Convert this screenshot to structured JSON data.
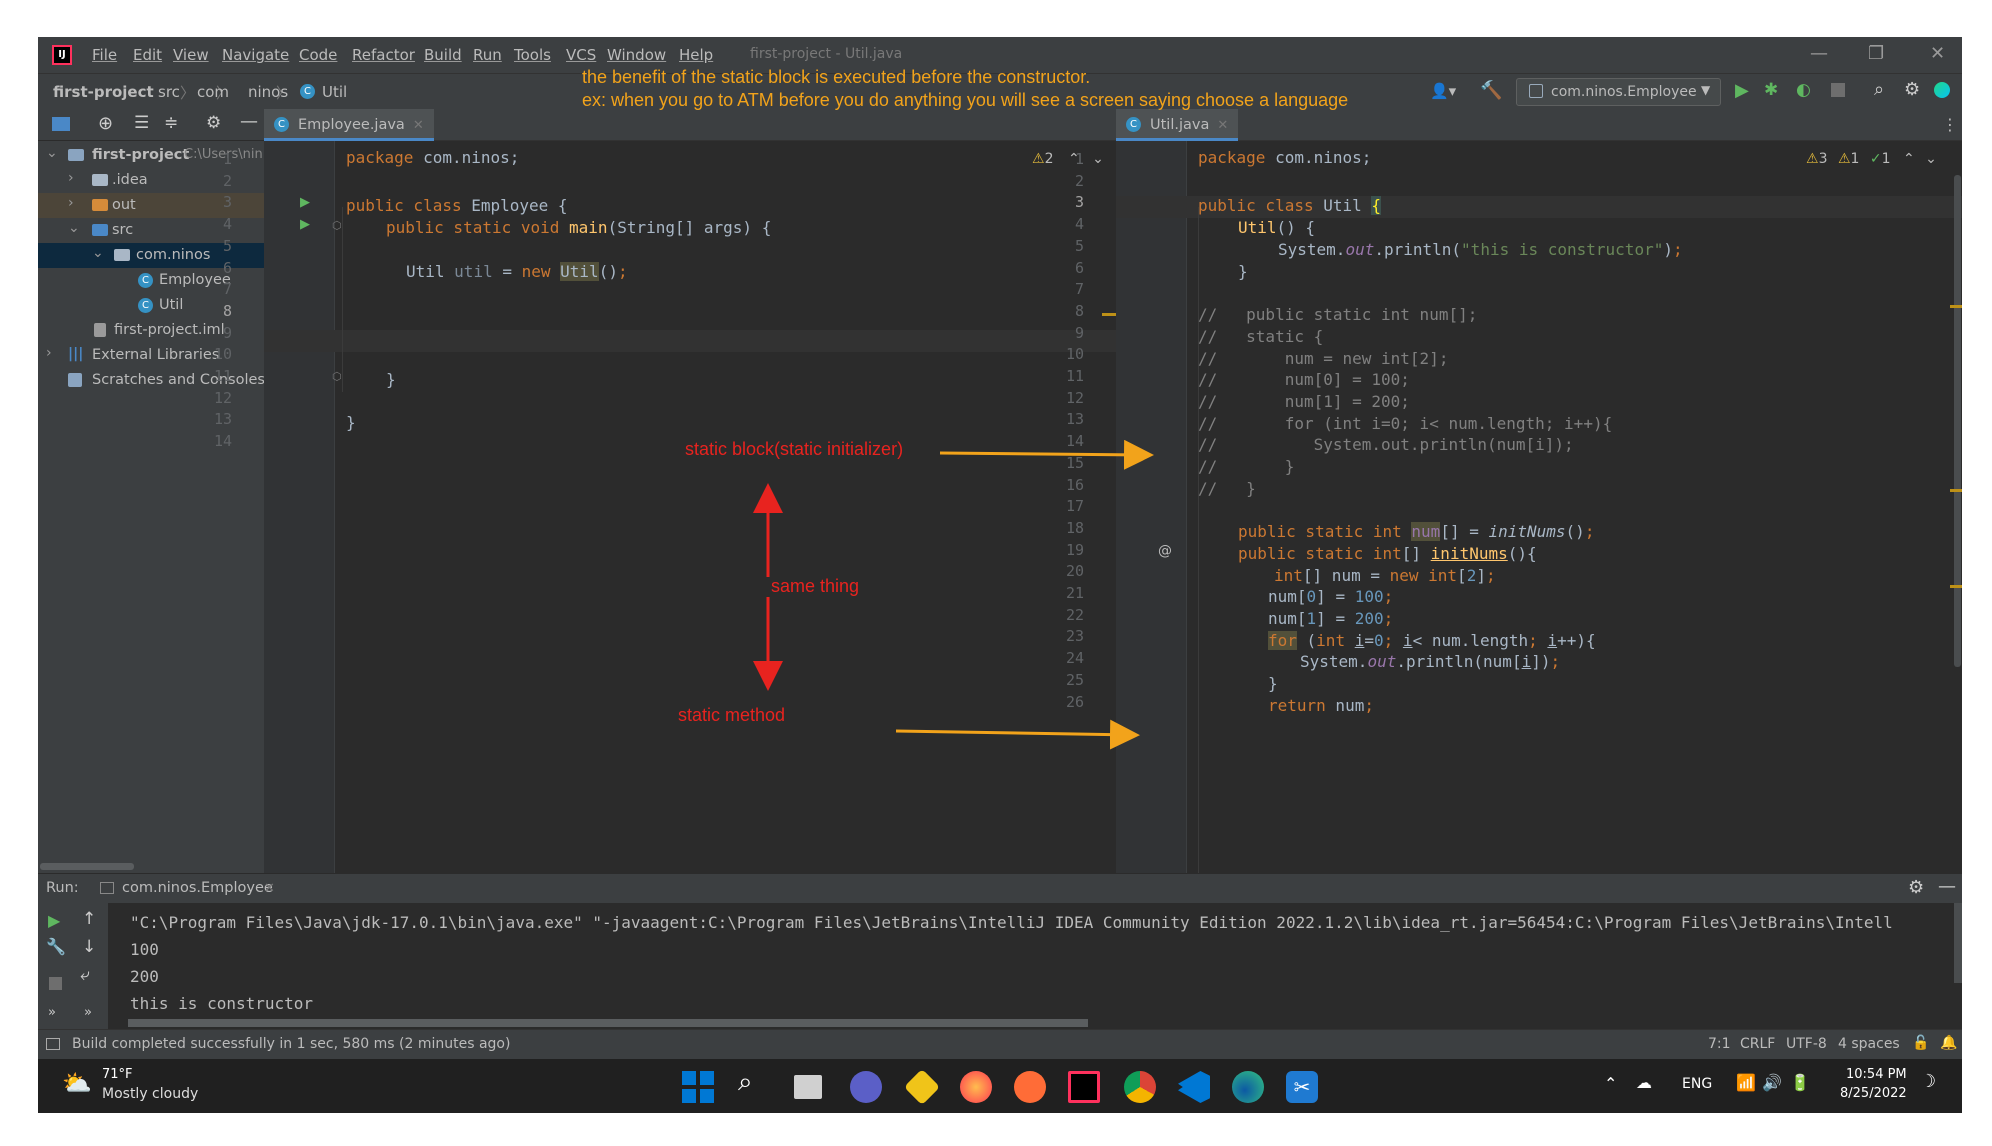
{
  "menu": {
    "items": [
      "File",
      "Edit",
      "View",
      "Navigate",
      "Code",
      "Refactor",
      "Build",
      "Run",
      "Tools",
      "VCS",
      "Window",
      "Help"
    ],
    "window_title": "first-project - Util.java"
  },
  "breadcrumb": {
    "project": "first-project",
    "src": "src",
    "com": "com",
    "ninos": "ninos",
    "cls": "Util"
  },
  "run_config": "com.ninos.Employee",
  "project_tree": {
    "root": "first-project",
    "root_path": "C:\\Users\\nin",
    "idea": ".idea",
    "out": "out",
    "src": "src",
    "pkg": "com.ninos",
    "employee": "Employee",
    "util": "Util",
    "iml": "first-project.iml",
    "ext": "External Libraries",
    "scratch": "Scratches and Consoles"
  },
  "editor1": {
    "tab": "Employee.java",
    "warnings": "2",
    "lines": [
      "1",
      "2",
      "3",
      "4",
      "5",
      "6",
      "7",
      "8",
      "9",
      "10",
      "11",
      "12",
      "13",
      "14"
    ]
  },
  "editor2": {
    "tab": "Util.java",
    "warn1": "3",
    "warn2": "1",
    "ok": "1",
    "lines": [
      "1",
      "2",
      "3",
      "4",
      "5",
      "6",
      "7",
      "8",
      "9",
      "10",
      "11",
      "12",
      "13",
      "14",
      "15",
      "16",
      "17",
      "18",
      "19",
      "20",
      "21",
      "22",
      "23",
      "24",
      "25",
      "26"
    ]
  },
  "annotations": {
    "top_line1": "the benefit of the static block is executed before the constructor.",
    "top_line2": "ex: when you go to ATM before you do anything you will see a screen saying choose a language",
    "static_block": "static block(static initializer)",
    "same_thing": "same thing",
    "static_method": "static method"
  },
  "run": {
    "label": "Run:",
    "tab": "com.ninos.Employee",
    "cmd": "\"C:\\Program Files\\Java\\jdk-17.0.1\\bin\\java.exe\" \"-javaagent:C:\\Program Files\\JetBrains\\IntelliJ IDEA Community Edition 2022.1.2\\lib\\idea_rt.jar=56454:C:\\Program Files\\JetBrains\\Intell",
    "out1": "100",
    "out2": "200",
    "out3": "this is constructor"
  },
  "status": {
    "msg": "Build completed successfully in 1 sec, 580 ms (2 minutes ago)",
    "pos": "7:1",
    "eol": "CRLF",
    "enc": "UTF-8",
    "indent": "4 spaces"
  },
  "taskbar": {
    "temp": "71°F",
    "weather": "Mostly cloudy",
    "lang": "ENG",
    "time": "10:54 PM",
    "date": "8/25/2022"
  },
  "colors": {
    "keyword": "#cc7832",
    "string": "#6a8759",
    "annotation_orange": "#f2a31b",
    "annotation_red": "#e8231f"
  }
}
